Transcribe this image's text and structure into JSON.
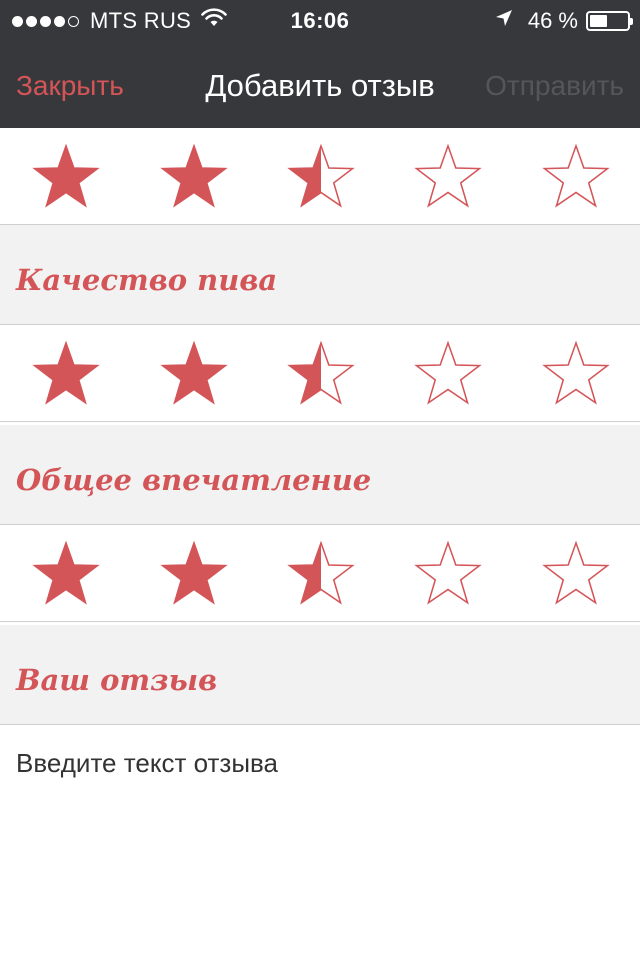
{
  "status_bar": {
    "carrier": "MTS RUS",
    "signal_bars_filled": 4,
    "signal_bars_total": 5,
    "time": "16:06",
    "battery_percent": "46 %",
    "battery_level": 0.46,
    "icons": [
      "wifi-icon",
      "location-arrow-icon",
      "battery-icon"
    ]
  },
  "nav": {
    "close_label": "Закрыть",
    "title": "Добавить отзыв",
    "send_label": "Отправить"
  },
  "colors": {
    "accent": "#d45558",
    "nav_background": "#37383c",
    "section_background": "#f2f2f2",
    "disabled_text": "#555659"
  },
  "ratings": [
    {
      "value": 2.5,
      "max": 5
    },
    {
      "label": "Качество пива",
      "value": 2.5,
      "max": 5
    },
    {
      "label": "Общее впечатление",
      "value": 2.5,
      "max": 5
    }
  ],
  "review": {
    "label": "Ваш отзыв",
    "placeholder": "Введите текст отзыва",
    "value": ""
  }
}
